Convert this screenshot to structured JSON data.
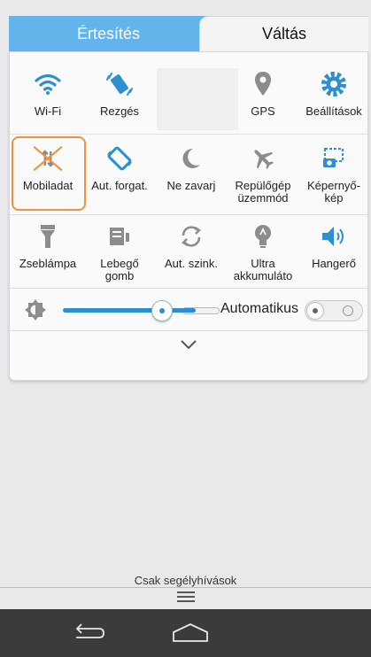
{
  "tabs": {
    "notifications": "Értesítés",
    "switches": "Váltás"
  },
  "tiles": {
    "wifi": "Wi-Fi",
    "vibrate": "Rezgés",
    "gps": "GPS",
    "settings": "Beállítások",
    "mobile_data": "Mobiladat",
    "auto_rotate": "Aut. forgat.",
    "dnd": "Ne zavarj",
    "airplane_1": "Repülőgép",
    "airplane_2": "üzemmód",
    "screenshot_1": "Képernyő-",
    "screenshot_2": "kép",
    "flashlight": "Zseblámpa",
    "floating_1": "Lebegő",
    "floating_2": "gomb",
    "auto_sync": "Aut. szink.",
    "ultra_1": "Ultra",
    "ultra_2": "akkumuláto",
    "volume": "Hangerő"
  },
  "brightness": {
    "auto_label": "Automatikus",
    "level": 0.62,
    "auto_enabled": false
  },
  "footer": {
    "emergency": "Csak segélyhívások"
  },
  "colors": {
    "accent": "#63b4ea",
    "icon_blue": "#2c8fd1",
    "highlight": "#f0913d",
    "navbar": "#3b3b3d"
  },
  "icons": [
    "wifi-icon",
    "vibrate-icon",
    "gps-icon",
    "settings-icon",
    "mobile-data-icon",
    "auto-rotate-icon",
    "moon-icon",
    "airplane-icon",
    "screenshot-icon",
    "flashlight-icon",
    "floating-button-icon",
    "sync-icon",
    "battery-saver-icon",
    "volume-icon",
    "brightness-icon",
    "chevron-down-icon",
    "back-icon",
    "home-icon",
    "menu-handle-icon"
  ]
}
